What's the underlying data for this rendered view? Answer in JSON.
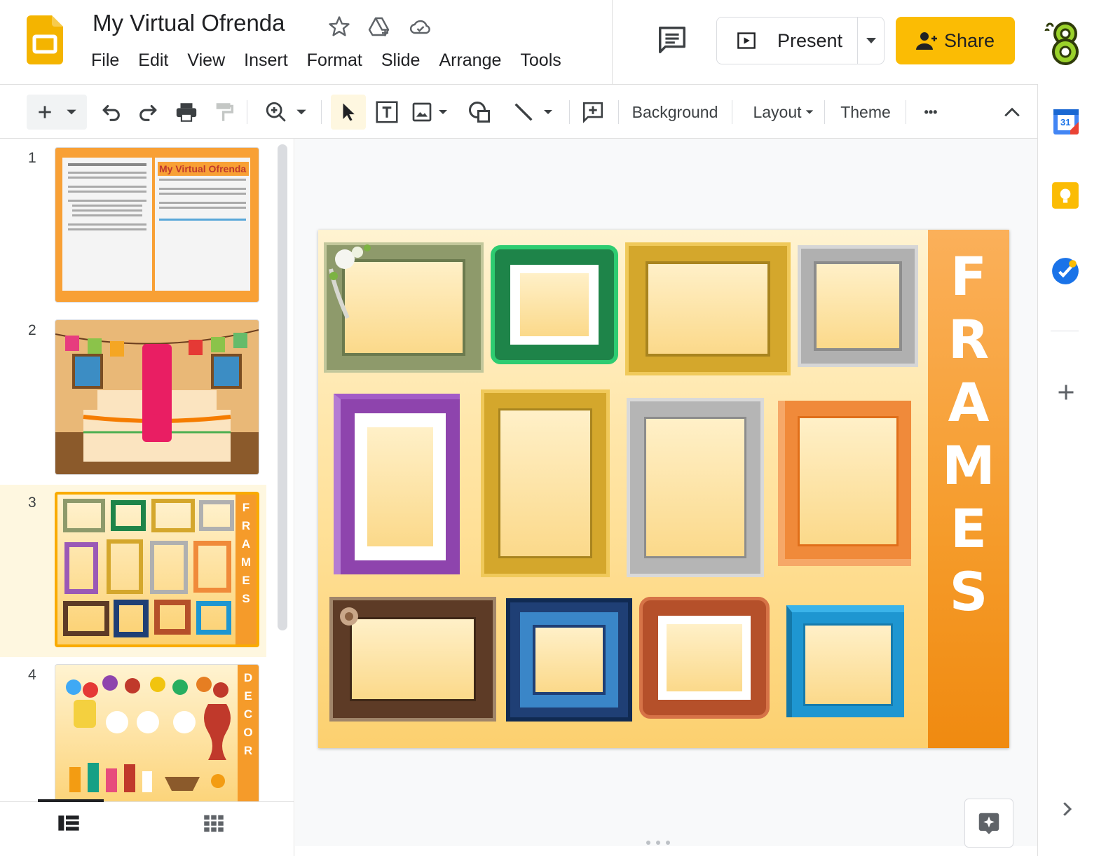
{
  "document": {
    "title": "My Virtual Ofrenda"
  },
  "menu": [
    "File",
    "Edit",
    "View",
    "Insert",
    "Format",
    "Slide",
    "Arrange",
    "Tools"
  ],
  "header": {
    "present_label": "Present",
    "share_label": "Share"
  },
  "toolbar": {
    "background_label": "Background",
    "layout_label": "Layout",
    "theme_label": "Theme",
    "more_label": "•••"
  },
  "filmstrip": {
    "slides": [
      {
        "number": "1",
        "thumb_title": "My Virtual Ofrenda"
      },
      {
        "number": "2"
      },
      {
        "number": "3",
        "selected": true,
        "thumb_side_text": "FRAMES"
      },
      {
        "number": "4",
        "thumb_side_text": "DECOR"
      }
    ]
  },
  "slide": {
    "side_title": [
      "F",
      "R",
      "A",
      "M",
      "E",
      "S"
    ]
  },
  "side_panel": {
    "calendar_label": "31"
  },
  "colors": {
    "accent": "#fbbc04",
    "slides_yellow": "#f4b400",
    "selected_border": "#f9ab00",
    "band_orange": "#f59b2a"
  },
  "icons": [
    "slides-logo-icon",
    "star-icon",
    "drive-icon",
    "cloud-icon",
    "comment-icon",
    "present-icon",
    "person-add-icon",
    "plus-icon",
    "undo-icon",
    "redo-icon",
    "print-icon",
    "paint-format-icon",
    "zoom-icon",
    "select-icon",
    "textbox-icon",
    "image-icon",
    "shape-icon",
    "line-icon",
    "add-comment-icon",
    "collapse-icon",
    "calendar-icon",
    "keep-icon",
    "tasks-icon",
    "explore-icon",
    "list-view-icon",
    "grid-view-icon",
    "chevron-right-icon"
  ]
}
